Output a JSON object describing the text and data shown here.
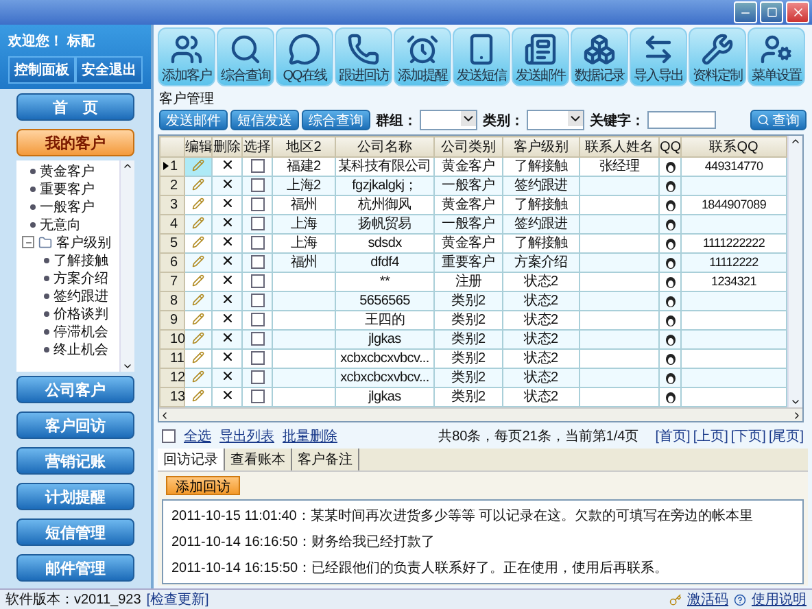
{
  "sidebar": {
    "welcome": "欢迎您！ 标配",
    "header_buttons": [
      "控制面板",
      "安全退出"
    ],
    "home": "首　页",
    "sections": [
      {
        "label": "我的客户",
        "selected": true
      },
      {
        "label": "公司客户",
        "selected": false
      },
      {
        "label": "客户回访",
        "selected": false
      },
      {
        "label": "营销记账",
        "selected": false
      },
      {
        "label": "计划提醒",
        "selected": false
      },
      {
        "label": "短信管理",
        "selected": false
      },
      {
        "label": "邮件管理",
        "selected": false
      }
    ],
    "tree": [
      {
        "label": "黄金客户"
      },
      {
        "label": "重要客户"
      },
      {
        "label": "一般客户"
      },
      {
        "label": "无意向"
      },
      {
        "label": "客户级别",
        "expanded": true,
        "children": [
          {
            "label": "了解接触"
          },
          {
            "label": "方案介绍"
          },
          {
            "label": "签约跟进"
          },
          {
            "label": "价格谈判"
          },
          {
            "label": "停滞机会"
          },
          {
            "label": "终止机会"
          }
        ]
      }
    ]
  },
  "toolbar": [
    "添加客户",
    "综合查询",
    "QQ在线",
    "跟进回访",
    "添加提醒",
    "发送短信",
    "发送邮件",
    "数据记录",
    "导入导出",
    "资料定制",
    "菜单设置"
  ],
  "group_title": "客户管理",
  "actions": [
    "发送邮件",
    "短信发送",
    "综合查询"
  ],
  "filters": [
    {
      "label": "群组："
    },
    {
      "label": "类别："
    }
  ],
  "keyword_label": "关键字：",
  "search_button": "查询",
  "table": {
    "columns": [
      "编辑",
      "删除",
      "选择",
      "地区2",
      "公司名称",
      "公司类别",
      "客户级别",
      "联系人姓名",
      "QQ",
      "联系QQ"
    ],
    "rows": [
      {
        "num": "1",
        "selected": true,
        "checked": false,
        "region": "福建2",
        "company": "某科技有限公司",
        "category": "黄金客户",
        "level_name": "了解接触",
        "contact": "张经理",
        "qq": "449314770"
      },
      {
        "num": "2",
        "selected": false,
        "checked": false,
        "region": "上海2",
        "company": "fgzjkalgkj；",
        "category": "一般客户",
        "level_name": "签约跟进",
        "contact": "",
        "qq": ""
      },
      {
        "num": "3",
        "selected": false,
        "checked": false,
        "region": "福州",
        "company": "杭州御风",
        "category": "黄金客户",
        "level_name": "了解接触",
        "contact": "",
        "qq": "1844907089"
      },
      {
        "num": "4",
        "selected": false,
        "checked": false,
        "region": "上海",
        "company": "扬帆贸易",
        "category": "一般客户",
        "level_name": "签约跟进",
        "contact": "",
        "qq": ""
      },
      {
        "num": "5",
        "selected": false,
        "checked": false,
        "region": "上海",
        "company": "sdsdx",
        "category": "黄金客户",
        "level_name": "了解接触",
        "contact": "",
        "qq": "1111222222"
      },
      {
        "num": "6",
        "selected": false,
        "checked": false,
        "region": "福州",
        "company": "dfdf4",
        "category": "重要客户",
        "level_name": "方案介绍",
        "contact": "",
        "qq": "11112222"
      },
      {
        "num": "7",
        "selected": false,
        "checked": false,
        "region": "",
        "company": "**",
        "category": "注册",
        "level_name": "状态2",
        "contact": "",
        "qq": "1234321"
      },
      {
        "num": "8",
        "selected": false,
        "checked": false,
        "region": "",
        "company": "5656565",
        "category": "类别2",
        "level_name": "状态2",
        "contact": "",
        "qq": ""
      },
      {
        "num": "9",
        "selected": false,
        "checked": false,
        "region": "",
        "company": "王四的",
        "category": "类别2",
        "level_name": "状态2",
        "contact": "",
        "qq": ""
      },
      {
        "num": "10",
        "selected": false,
        "checked": false,
        "region": "",
        "company": "jlgkas",
        "category": "类别2",
        "level_name": "状态2",
        "contact": "",
        "qq": ""
      },
      {
        "num": "11",
        "selected": false,
        "checked": false,
        "region": "",
        "company": "xcbxcbcxvbcv...",
        "category": "类别2",
        "level_name": "状态2",
        "contact": "",
        "qq": ""
      },
      {
        "num": "12",
        "selected": false,
        "checked": false,
        "region": "",
        "company": "xcbxcbcxvbcv...",
        "category": "类别2",
        "level_name": "状态2",
        "contact": "",
        "qq": ""
      },
      {
        "num": "13",
        "selected": false,
        "checked": false,
        "region": "",
        "company": "jlgkas",
        "category": "类别2",
        "level_name": "状态2",
        "contact": "",
        "qq": ""
      }
    ]
  },
  "bulk": {
    "select_all_checked": false,
    "links": [
      "全选",
      "导出列表",
      "批量删除"
    ]
  },
  "pagination": {
    "summary": "共80条，每页21条，当前第1/4页",
    "links": [
      "[首页]",
      "[上页]",
      "[下页]",
      "[尾页]"
    ]
  },
  "tabs": [
    {
      "label": "回访记录",
      "selected": true
    },
    {
      "label": "查看账本",
      "selected": false
    },
    {
      "label": "客户备注",
      "selected": false
    }
  ],
  "add_visit_button": "添加回访",
  "log": [
    "2011-10-15 11:01:40：某某时间再次进货多少等等 可以记录在这。欠款的可填写在旁边的帐本里",
    "2011-10-14 16:16:50：财务给我已经打款了",
    "2011-10-14 16:15:50：已经跟他们的负责人联系好了。正在使用，使用后再联系。"
  ],
  "status_bar": {
    "version": "软件版本：v2011_923",
    "update_link": "[检查更新]",
    "links": [
      "激活码",
      "使用说明"
    ]
  }
}
